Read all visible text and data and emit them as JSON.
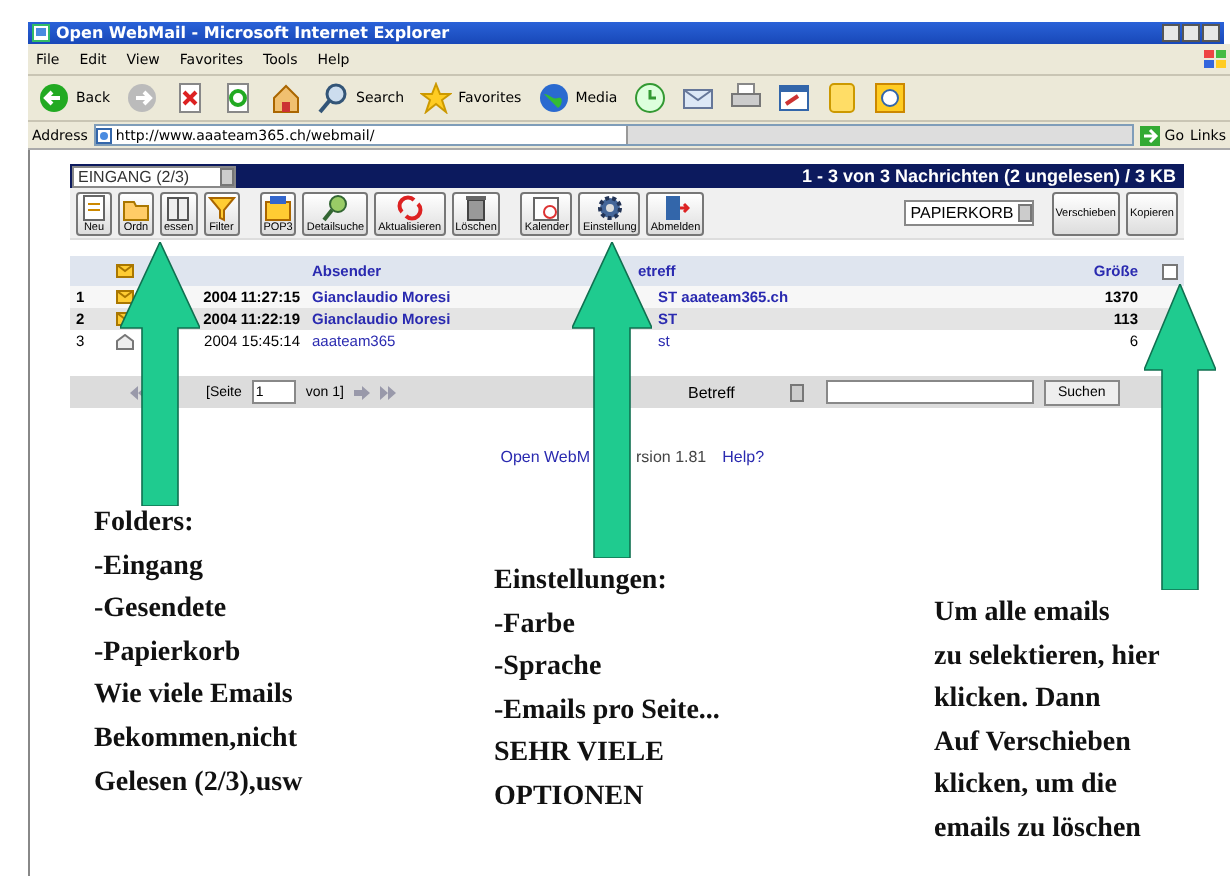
{
  "window": {
    "title": "Open WebMail - Microsoft Internet Explorer"
  },
  "menu": [
    "File",
    "Edit",
    "View",
    "Favorites",
    "Tools",
    "Help"
  ],
  "browser_toolbar": [
    {
      "kind": "back",
      "label": "Back"
    },
    {
      "kind": "forward"
    },
    {
      "kind": "stop"
    },
    {
      "kind": "refresh"
    },
    {
      "kind": "home"
    },
    {
      "kind": "search",
      "label": "Search"
    },
    {
      "kind": "favorites",
      "label": "Favorites"
    },
    {
      "kind": "media",
      "label": "Media"
    },
    {
      "kind": "history"
    },
    {
      "kind": "mail"
    },
    {
      "kind": "print"
    },
    {
      "kind": "edit"
    },
    {
      "kind": "notes"
    },
    {
      "kind": "messenger"
    }
  ],
  "address": {
    "label": "Address",
    "value": "http://www.aaateam365.ch/webmail/",
    "go": "Go",
    "links": "Links"
  },
  "mail": {
    "folder": "EINGANG (2/3)",
    "summary": "1 - 3 von 3 Nachrichten (2 ungelesen) / 3 KB",
    "tools": [
      {
        "kind": "page",
        "label": "Neu"
      },
      {
        "kind": "folder",
        "label": "Ordn"
      },
      {
        "kind": "book",
        "label": "essen"
      },
      {
        "kind": "funnel",
        "label": "Filter"
      },
      {
        "kind": "mailbox",
        "label": "POP3"
      },
      {
        "kind": "magnifier",
        "label": "Detailsuche"
      },
      {
        "kind": "arrows",
        "label": "Aktualisieren"
      },
      {
        "kind": "bin",
        "label": "Löschen"
      },
      {
        "kind": "calendar",
        "label": "Kalender"
      },
      {
        "kind": "gear",
        "label": "Einstellung"
      },
      {
        "kind": "door",
        "label": "Abmelden"
      }
    ],
    "move_target": "PAPIERKORB",
    "move": "Verschieben",
    "copy": "Kopieren",
    "columns": {
      "sender": "Absender",
      "subject": "etreff",
      "size": "Größe"
    },
    "select_all": {
      "checked": false
    },
    "rows": [
      {
        "number": "1",
        "unread": true,
        "date": "2004 11:27:15",
        "sender": "Gianclaudio Moresi",
        "subject": "ST aaateam365.ch",
        "size": "1370"
      },
      {
        "number": "2",
        "unread": true,
        "date": "2004 11:22:19",
        "sender": "Gianclaudio Moresi",
        "subject": "ST",
        "size": "113"
      },
      {
        "number": "3",
        "unread": false,
        "date": "2004 15:45:14",
        "sender": "aaateam365",
        "subject": "st",
        "size": "6"
      }
    ],
    "pager": {
      "page_label": "[Seite",
      "page": "1",
      "of": "von 1]",
      "search_field": "Betreff",
      "search": "Suchen"
    },
    "footer": {
      "name": "Open WebM",
      "version": "rsion 1.81",
      "help": "Help?"
    }
  },
  "notes": [
    {
      "lines": [
        "Folders:",
        "-Eingang",
        "-Gesendete",
        "-Papierkorb",
        "Wie viele Emails",
        "Bekommen,nicht",
        "Gelesen (2/3),usw"
      ]
    },
    {
      "lines": [
        "Einstellungen:",
        "-Farbe",
        "-Sprache",
        "-Emails pro Seite...",
        "SEHR VIELE",
        "OPTIONEN"
      ]
    },
    {
      "lines": [
        "Um alle emails",
        "zu selektieren, hier",
        "klicken. Dann",
        "Auf Verschieben",
        "klicken, um die",
        "emails zu löschen"
      ]
    }
  ]
}
